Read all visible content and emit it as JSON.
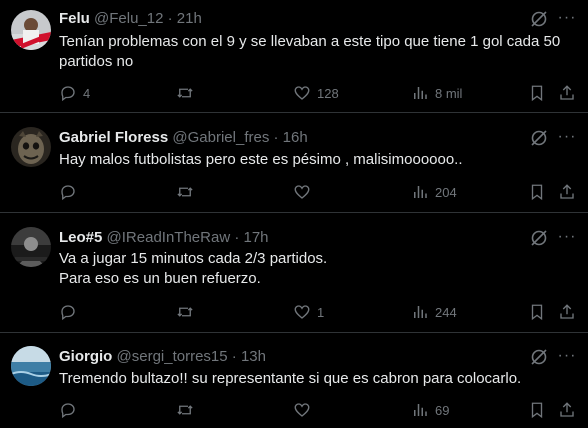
{
  "replies": [
    {
      "name": "Felu",
      "handle": "@Felu_12",
      "separator": " · ",
      "time": "21h",
      "text_lines": [
        "Tenían problemas con el 9 y se llevaban a este tipo que tiene 1 gol cada 50",
        "partidos no"
      ],
      "stats": {
        "replies": "4",
        "reposts": "",
        "likes": "128",
        "views": "8 mil"
      }
    },
    {
      "name": "Gabriel Floress",
      "handle": "@Gabriel_fres",
      "separator": " · ",
      "time": "16h",
      "text_lines": [
        "Hay malos futbolistas pero este es pésimo , malisimoooooo.."
      ],
      "stats": {
        "replies": "",
        "reposts": "",
        "likes": "",
        "views": "204"
      }
    },
    {
      "name": "Leo#5",
      "handle": "@IReadInTheRaw",
      "separator": " · ",
      "time": "17h",
      "text_lines": [
        "Va a jugar 15 minutos cada 2/3 partidos.",
        "Para eso es un buen refuerzo."
      ],
      "stats": {
        "replies": "",
        "reposts": "",
        "likes": "1",
        "views": "244"
      }
    },
    {
      "name": "Giorgio",
      "handle": "@sergi_torres15",
      "separator": " · ",
      "time": "13h",
      "text_lines": [
        "Tremendo bultazo!! su representante si que es cabron para colocarlo."
      ],
      "stats": {
        "replies": "",
        "reposts": "",
        "likes": "",
        "views": "69"
      }
    }
  ],
  "icons": {
    "more": "···",
    "grok": "grok-icon",
    "reply": "reply-icon",
    "repost": "repost-icon",
    "like": "heart-icon",
    "views": "views-icon",
    "bookmark": "bookmark-icon",
    "share": "share-icon"
  },
  "colors": {
    "background": "#000000",
    "text": "#e7e9ea",
    "muted": "#71767b",
    "divider": "#2f3336"
  }
}
